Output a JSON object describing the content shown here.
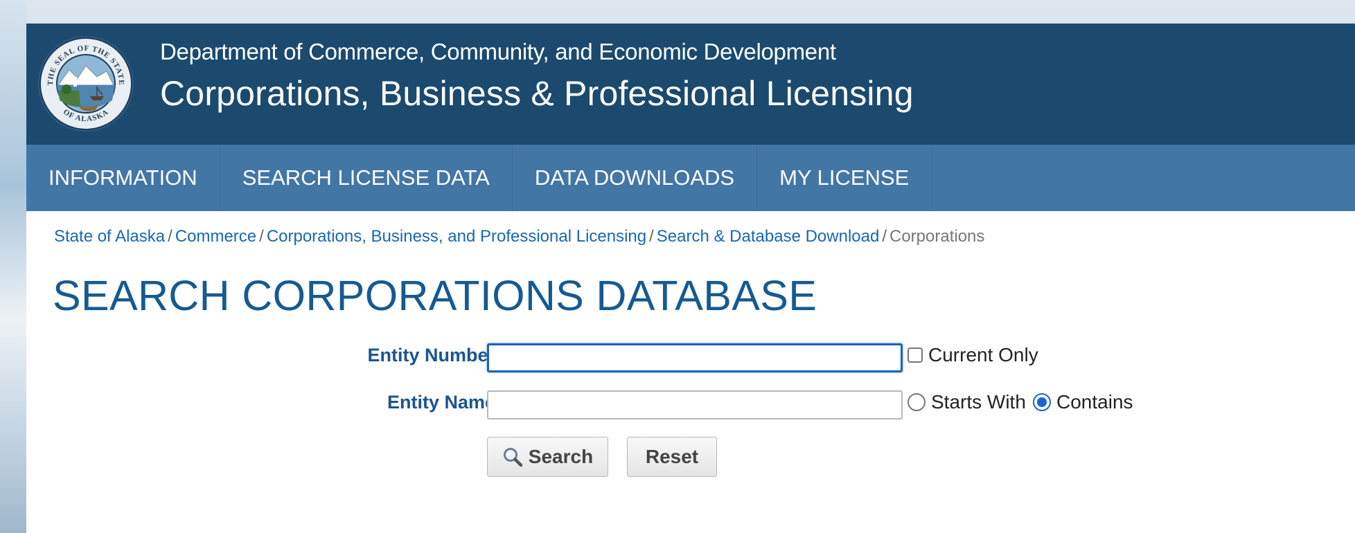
{
  "header": {
    "department": "Department of Commerce, Community, and Economic Development",
    "division": "Corporations, Business & Professional Licensing",
    "seal_icon": "state-seal-of-alaska",
    "seal_text_top": "THE SEAL OF THE STATE",
    "seal_text_bottom": "OF ALASKA"
  },
  "nav": {
    "items": [
      {
        "label": "INFORMATION"
      },
      {
        "label": "SEARCH LICENSE DATA"
      },
      {
        "label": "DATA DOWNLOADS"
      },
      {
        "label": "MY LICENSE"
      }
    ]
  },
  "breadcrumb": {
    "items": [
      {
        "label": "State of Alaska"
      },
      {
        "label": "Commerce"
      },
      {
        "label": "Corporations, Business, and Professional Licensing"
      },
      {
        "label": "Search & Database Download"
      }
    ],
    "separator": "/",
    "current": "Corporations"
  },
  "page": {
    "title": "SEARCH CORPORATIONS DATABASE"
  },
  "form": {
    "entity_number": {
      "label": "Entity Number:",
      "value": "",
      "current_only_label": "Current Only",
      "current_only_checked": false
    },
    "entity_name": {
      "label": "Entity Name:",
      "value": "",
      "starts_with_label": "Starts With",
      "contains_label": "Contains",
      "selected_mode": "Contains"
    },
    "search_button": "Search",
    "reset_button": "Reset",
    "search_icon": "magnifying-glass-icon"
  },
  "colors": {
    "header_bg": "#1b4a6e",
    "nav_bg": "#4277a5",
    "title": "#155a92",
    "link": "#1569b1",
    "label": "#1a5590"
  }
}
